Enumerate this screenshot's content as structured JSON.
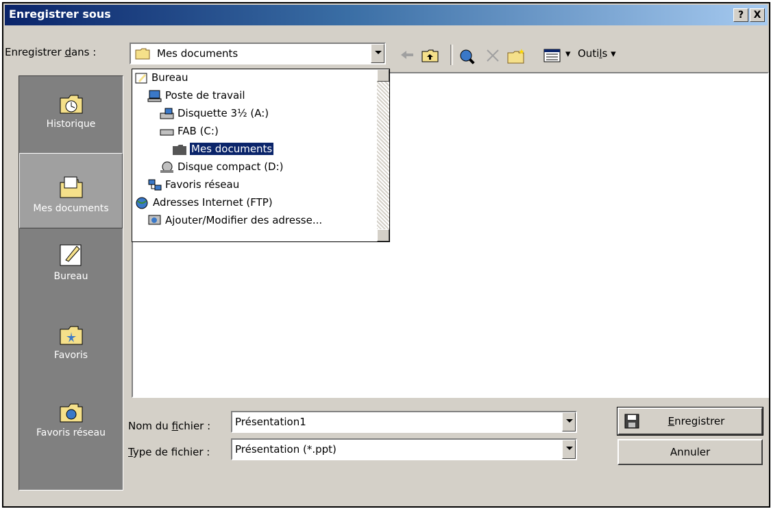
{
  "window": {
    "title": "Enregistrer sous",
    "help_btn": "?",
    "close_btn": "X"
  },
  "save_in": {
    "label_pre": "Enregistrer ",
    "label_u": "d",
    "label_post": "ans :",
    "value": "Mes documents"
  },
  "toolbar": {
    "tools_pre": "Outi",
    "tools_u": "l",
    "tools_post": "s",
    "tools_arrow": "▾",
    "views_arrow": "▾"
  },
  "places": [
    {
      "label": "Historique"
    },
    {
      "label": "Mes documents"
    },
    {
      "label": "Bureau"
    },
    {
      "label": "Favoris"
    },
    {
      "label": "Favoris réseau"
    }
  ],
  "dropdown": [
    {
      "label": "Bureau",
      "icon": "desktop-icon"
    },
    {
      "label": "Poste de travail",
      "icon": "computer-icon"
    },
    {
      "label": "Disquette 3½ (A:)",
      "icon": "floppy-icon"
    },
    {
      "label": "FAB (C:)",
      "icon": "drive-icon"
    },
    {
      "label": "Mes documents",
      "icon": "folder-icon"
    },
    {
      "label": "Disque compact (D:)",
      "icon": "cdrom-icon"
    },
    {
      "label": "Favoris réseau",
      "icon": "network-icon"
    },
    {
      "label": "Adresses Internet (FTP)",
      "icon": "globe-icon"
    },
    {
      "label": "Ajouter/Modifier des adresse...",
      "icon": "ftp-icon"
    }
  ],
  "filename": {
    "label_pre": "Nom du ",
    "label_u": "f",
    "label_post": "ichier :",
    "value": "Présentation1"
  },
  "filetype": {
    "label_pre": "",
    "label_u": "T",
    "label_post": "ype de fichier :",
    "value": "Présentation (*.ppt)"
  },
  "buttons": {
    "save_u": "E",
    "save_rest": "nregistrer",
    "cancel": "Annuler"
  },
  "colors": {
    "titlebar": "#0a246a",
    "face": "#d4d0c8",
    "places_bg": "#808080",
    "selection": "#0a246a"
  }
}
